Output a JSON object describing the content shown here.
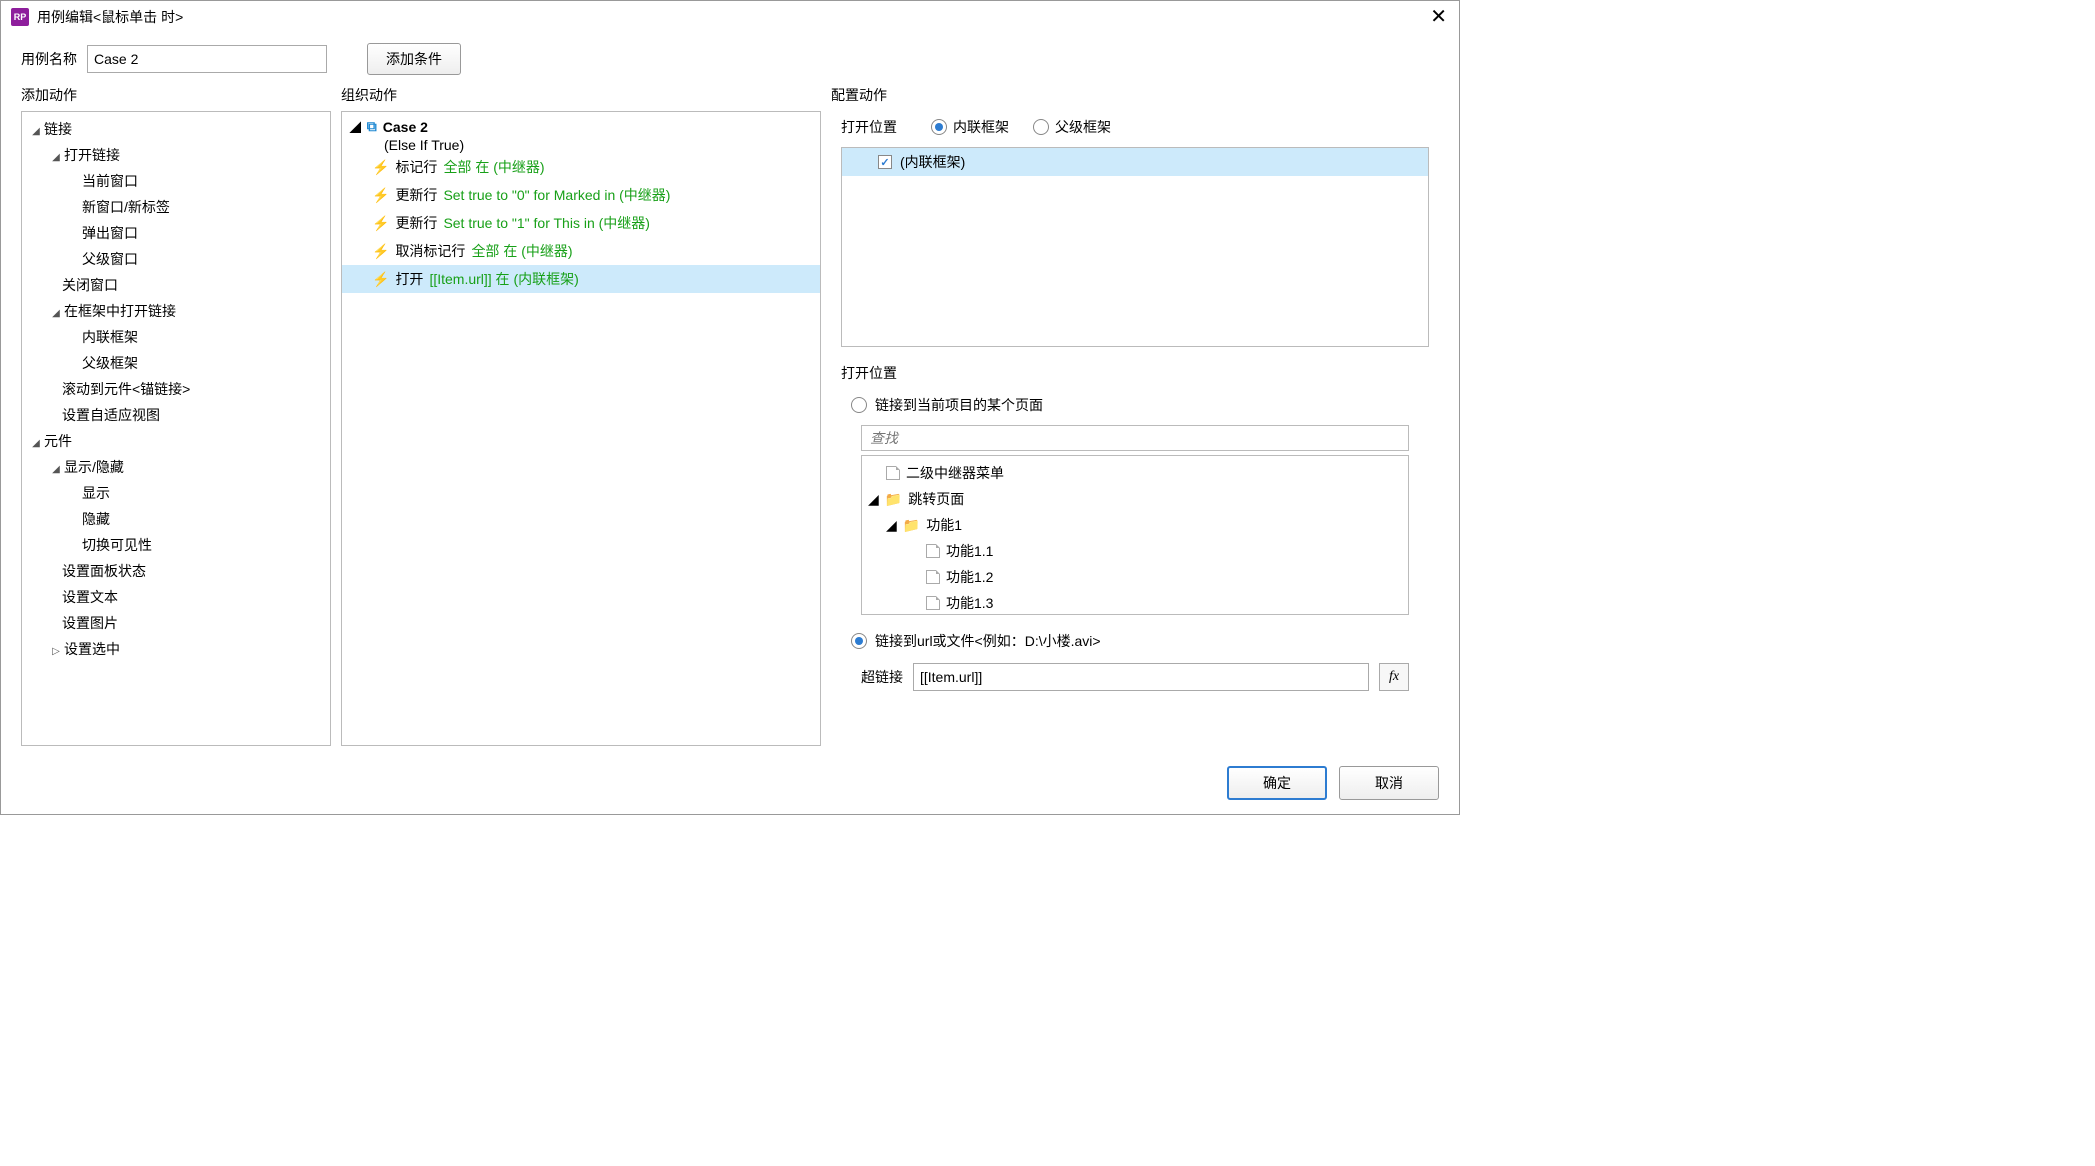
{
  "window": {
    "app_icon_text": "RP",
    "title": "用例编辑<鼠标单击 时>"
  },
  "toprow": {
    "name_label": "用例名称",
    "name_value": "Case 2",
    "add_condition": "添加条件"
  },
  "headers": {
    "add_action": "添加动作",
    "organize_action": "组织动作",
    "config_action": "配置动作"
  },
  "left_tree": {
    "g1": "链接",
    "g1_1": "打开链接",
    "g1_1_1": "当前窗口",
    "g1_1_2": "新窗口/新标签",
    "g1_1_3": "弹出窗口",
    "g1_1_4": "父级窗口",
    "g1_2": "关闭窗口",
    "g1_3": "在框架中打开链接",
    "g1_3_1": "内联框架",
    "g1_3_2": "父级框架",
    "g1_4": "滚动到元件<锚链接>",
    "g1_5": "设置自适应视图",
    "g2": "元件",
    "g2_1": "显示/隐藏",
    "g2_1_1": "显示",
    "g2_1_2": "隐藏",
    "g2_1_3": "切换可见性",
    "g2_2": "设置面板状态",
    "g2_3": "设置文本",
    "g2_4": "设置图片",
    "g2_5": "设置选中"
  },
  "mid": {
    "case_name": "Case 2",
    "case_cond": "(Else If True)",
    "a1_pre": "标记行",
    "a1_grn": "全部 在 (中继器)",
    "a2_pre": "更新行",
    "a2_grn": "Set true to \"0\" for Marked in (中继器)",
    "a3_pre": "更新行",
    "a3_grn": "Set true to \"1\" for This in (中继器)",
    "a4_pre": "取消标记行",
    "a4_grn": "全部 在 (中继器)",
    "a5_pre": "打开",
    "a5_grn": "[[Item.url]] 在 (内联框架)"
  },
  "right": {
    "open_in_label": "打开位置",
    "radio_inline": "内联框架",
    "radio_parent": "父级框架",
    "target_item": "(内联框架)",
    "location_label": "打开位置",
    "radio_link_page": "链接到当前项目的某个页面",
    "search_placeholder": "查找",
    "pt_1": "二级中继器菜单",
    "pt_2": "跳转页面",
    "pt_3": "功能1",
    "pt_4": "功能1.1",
    "pt_5": "功能1.2",
    "pt_6": "功能1.3",
    "radio_link_url": "链接到url或文件<例如：D:\\小楼.avi>",
    "hyperlink_label": "超链接",
    "hyperlink_value": "[[Item.url]]",
    "fx": "fx"
  },
  "buttons": {
    "ok": "确定",
    "cancel": "取消"
  }
}
